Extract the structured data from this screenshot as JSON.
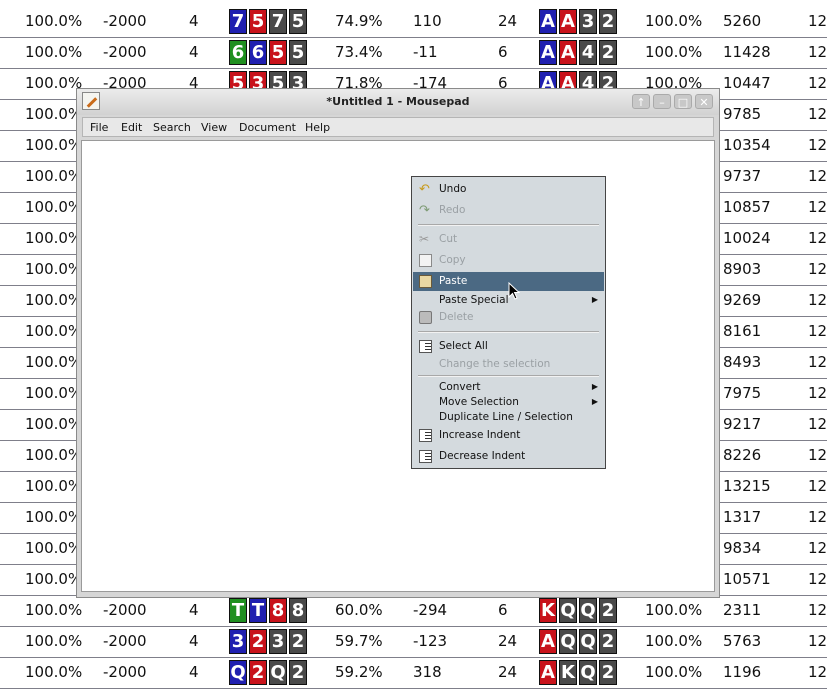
{
  "colors": {
    "card_blue": "#1f1fb0",
    "card_red": "#c8121b",
    "card_green": "#1f8f1f",
    "card_gray": "#4a4a4a",
    "menu_highlight": "#4b6983"
  },
  "table_rows": [
    {
      "c0": "100.0%",
      "c1": "-2000",
      "c2": "4",
      "h1": [
        [
          "7",
          "blue"
        ],
        [
          "5",
          "red"
        ],
        [
          "7",
          "gray"
        ],
        [
          "5",
          "gray"
        ]
      ],
      "c4": "74.9%",
      "c5": "110",
      "c6": "24",
      "h2": [
        [
          "A",
          "blue"
        ],
        [
          "A",
          "red"
        ],
        [
          "3",
          "gray"
        ],
        [
          "2",
          "gray"
        ]
      ],
      "c8": "100.0%",
      "c9": "5260",
      "c10": "12"
    },
    {
      "c0": "100.0%",
      "c1": "-2000",
      "c2": "4",
      "h1": [
        [
          "6",
          "green"
        ],
        [
          "6",
          "blue"
        ],
        [
          "5",
          "red"
        ],
        [
          "5",
          "gray"
        ]
      ],
      "c4": "73.4%",
      "c5": "-11",
      "c6": "6",
      "h2": [
        [
          "A",
          "blue"
        ],
        [
          "A",
          "red"
        ],
        [
          "4",
          "gray"
        ],
        [
          "2",
          "gray"
        ]
      ],
      "c8": "100.0%",
      "c9": "11428",
      "c10": "12"
    },
    {
      "c0": "100.0%",
      "c1": "-2000",
      "c2": "4",
      "h1": [
        [
          "5",
          "red"
        ],
        [
          "3",
          "red"
        ],
        [
          "5",
          "gray"
        ],
        [
          "3",
          "gray"
        ]
      ],
      "c4": "71.8%",
      "c5": "-174",
      "c6": "6",
      "h2": [
        [
          "A",
          "blue"
        ],
        [
          "A",
          "red"
        ],
        [
          "4",
          "gray"
        ],
        [
          "2",
          "gray"
        ]
      ],
      "c8": "100.0%",
      "c9": "10447",
      "c10": "12"
    },
    {
      "c0": "100.0%",
      "c9": "9785",
      "c10": "12"
    },
    {
      "c0": "100.0%",
      "c9": "10354",
      "c10": "12"
    },
    {
      "c0": "100.0%",
      "c9": "9737",
      "c10": "12"
    },
    {
      "c0": "100.0%",
      "c9": "10857",
      "c10": "12"
    },
    {
      "c0": "100.0%",
      "c9": "10024",
      "c10": "12"
    },
    {
      "c0": "100.0%",
      "c9": "8903",
      "c10": "12"
    },
    {
      "c0": "100.0%",
      "c9": "9269",
      "c10": "12"
    },
    {
      "c0": "100.0%",
      "c9": "8161",
      "c10": "12"
    },
    {
      "c0": "100.0%",
      "c9": "8493",
      "c10": "12"
    },
    {
      "c0": "100.0%",
      "c9": "7975",
      "c10": "12"
    },
    {
      "c0": "100.0%",
      "c9": "9217",
      "c10": "12"
    },
    {
      "c0": "100.0%",
      "c9": "8226",
      "c10": "12"
    },
    {
      "c0": "100.0%",
      "c9": "13215",
      "c10": "12"
    },
    {
      "c0": "100.0%",
      "c9": "1317",
      "c10": "12"
    },
    {
      "c0": "100.0%",
      "c9": "9834",
      "c10": "12"
    },
    {
      "c0": "100.0%",
      "c9": "10571",
      "c10": "12"
    },
    {
      "c0": "100.0%",
      "c1": "-2000",
      "c2": "4",
      "h1": [
        [
          "T",
          "green"
        ],
        [
          "T",
          "blue"
        ],
        [
          "8",
          "red"
        ],
        [
          "8",
          "gray"
        ]
      ],
      "c4": "60.0%",
      "c5": "-294",
      "c6": "6",
      "h2": [
        [
          "K",
          "red"
        ],
        [
          "Q",
          "gray"
        ],
        [
          "Q",
          "gray"
        ],
        [
          "2",
          "gray"
        ]
      ],
      "c8": "100.0%",
      "c9": "2311",
      "c10": "12"
    },
    {
      "c0": "100.0%",
      "c1": "-2000",
      "c2": "4",
      "h1": [
        [
          "3",
          "blue"
        ],
        [
          "2",
          "red"
        ],
        [
          "3",
          "gray"
        ],
        [
          "2",
          "gray"
        ]
      ],
      "c4": "59.7%",
      "c5": "-123",
      "c6": "24",
      "h2": [
        [
          "A",
          "red"
        ],
        [
          "Q",
          "gray"
        ],
        [
          "Q",
          "gray"
        ],
        [
          "2",
          "gray"
        ]
      ],
      "c8": "100.0%",
      "c9": "5763",
      "c10": "12"
    },
    {
      "c0": "100.0%",
      "c1": "-2000",
      "c2": "4",
      "h1": [
        [
          "Q",
          "blue"
        ],
        [
          "2",
          "red"
        ],
        [
          "Q",
          "gray"
        ],
        [
          "2",
          "gray"
        ]
      ],
      "c4": "59.2%",
      "c5": "318",
      "c6": "24",
      "h2": [
        [
          "A",
          "red"
        ],
        [
          "K",
          "gray"
        ],
        [
          "Q",
          "gray"
        ],
        [
          "2",
          "gray"
        ]
      ],
      "c8": "100.0%",
      "c9": "1196",
      "c10": "12"
    }
  ],
  "window": {
    "title": "*Untitled 1 - Mousepad",
    "menu": [
      "File",
      "Edit",
      "Search",
      "View",
      "Document",
      "Help"
    ]
  },
  "context_menu": {
    "undo": "Undo",
    "redo": "Redo",
    "cut": "Cut",
    "copy": "Copy",
    "paste": "Paste",
    "paste_special": "Paste Special",
    "delete": "Delete",
    "select_all": "Select All",
    "change_selection": "Change the selection",
    "convert": "Convert",
    "move_selection": "Move Selection",
    "duplicate": "Duplicate Line / Selection",
    "increase_indent": "Increase Indent",
    "decrease_indent": "Decrease Indent"
  }
}
